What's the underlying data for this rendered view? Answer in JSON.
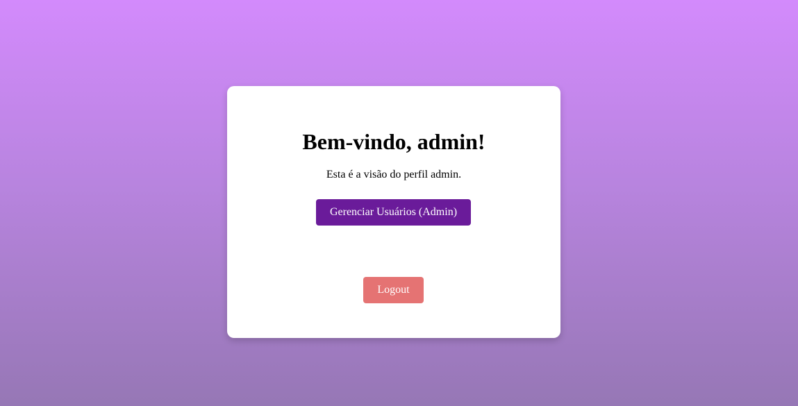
{
  "welcome": {
    "title": "Bem-vindo, admin!",
    "subtitle": "Esta é a visão do perfil admin."
  },
  "actions": {
    "manage_users_label": "Gerenciar Usuários (Admin)",
    "logout_label": "Logout"
  },
  "colors": {
    "admin_button": "#6a1b9a",
    "logout_button": "#e57373",
    "gradient_top": "#d38afc",
    "gradient_bottom": "#9677b5"
  }
}
